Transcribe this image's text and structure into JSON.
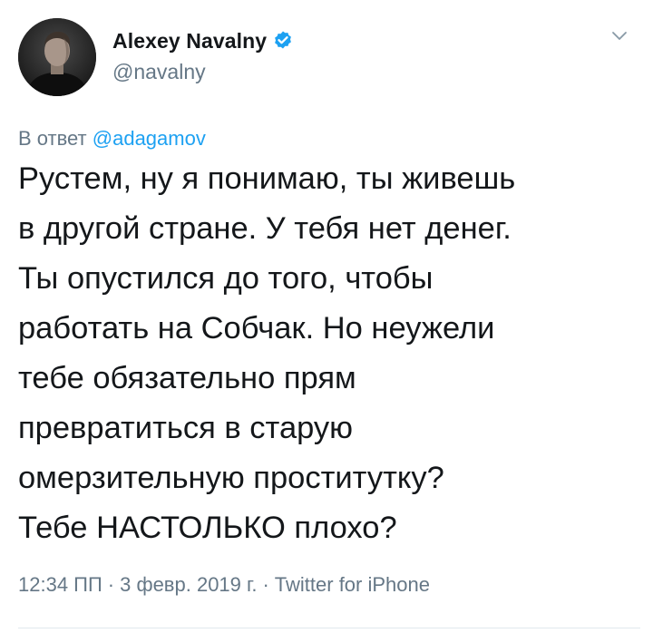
{
  "author": {
    "display_name": "Alexey Navalny",
    "handle": "@navalny",
    "verified": true
  },
  "reply": {
    "prefix": "В ответ",
    "mention": "@adagamov"
  },
  "tweet": {
    "lines": [
      "Рустем, ну я понимаю, ты живешь",
      "в другой стране. У тебя нет денег.",
      "Ты опустился до того, чтобы",
      "работать на Собчак. Но неужели",
      "тебе обязательно прям",
      "превратиться в старую",
      "омерзительную проститутку?",
      "Тебе НАСТОЛЬКО плохо?"
    ]
  },
  "meta": {
    "time": "12:34 ПП",
    "date": "3 февр. 2019 г.",
    "separator": "·",
    "source": "Twitter for iPhone"
  },
  "icons": {
    "verified": "verified-badge-icon",
    "menu": "chevron-down-icon"
  },
  "colors": {
    "accent": "#1da1f2",
    "text": "#14171a",
    "secondary": "#657786",
    "divider": "#e1e8ed"
  }
}
